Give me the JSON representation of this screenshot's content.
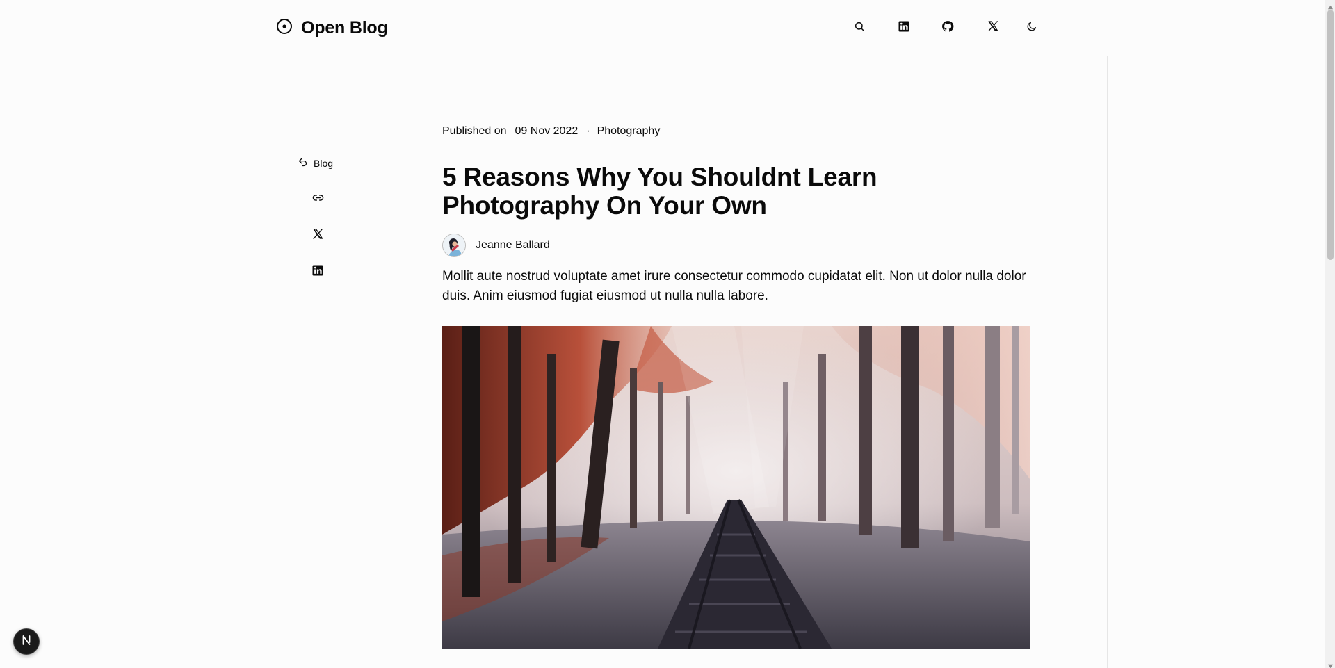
{
  "header": {
    "brand": "Open Blog",
    "icons": [
      "search-icon",
      "linkedin-icon",
      "github-icon",
      "x-icon",
      "moon-icon"
    ]
  },
  "share": {
    "back_label": "Blog",
    "icons": [
      "undo-arrow-icon",
      "link-icon",
      "x-icon",
      "linkedin-icon"
    ]
  },
  "article": {
    "published_prefix": "Published on",
    "date": "09 Nov 2022",
    "separator": "·",
    "category": "Photography",
    "title": "5 Reasons Why You Shouldnt Learn Photography On Your Own",
    "author": "Jeanne Ballard",
    "excerpt": "Mollit aute nostrud voluptate amet irure consectetur commodo cupidatat elit. Non ut dolor nulla dolor duis. Anim eiusmod fugiat eiusmod ut nulla nulla labore."
  },
  "badge": {
    "letter": "N"
  },
  "colors": {
    "background": "#fcfcfc",
    "text": "#0a0a0a",
    "badge": "#1a1a1a"
  }
}
